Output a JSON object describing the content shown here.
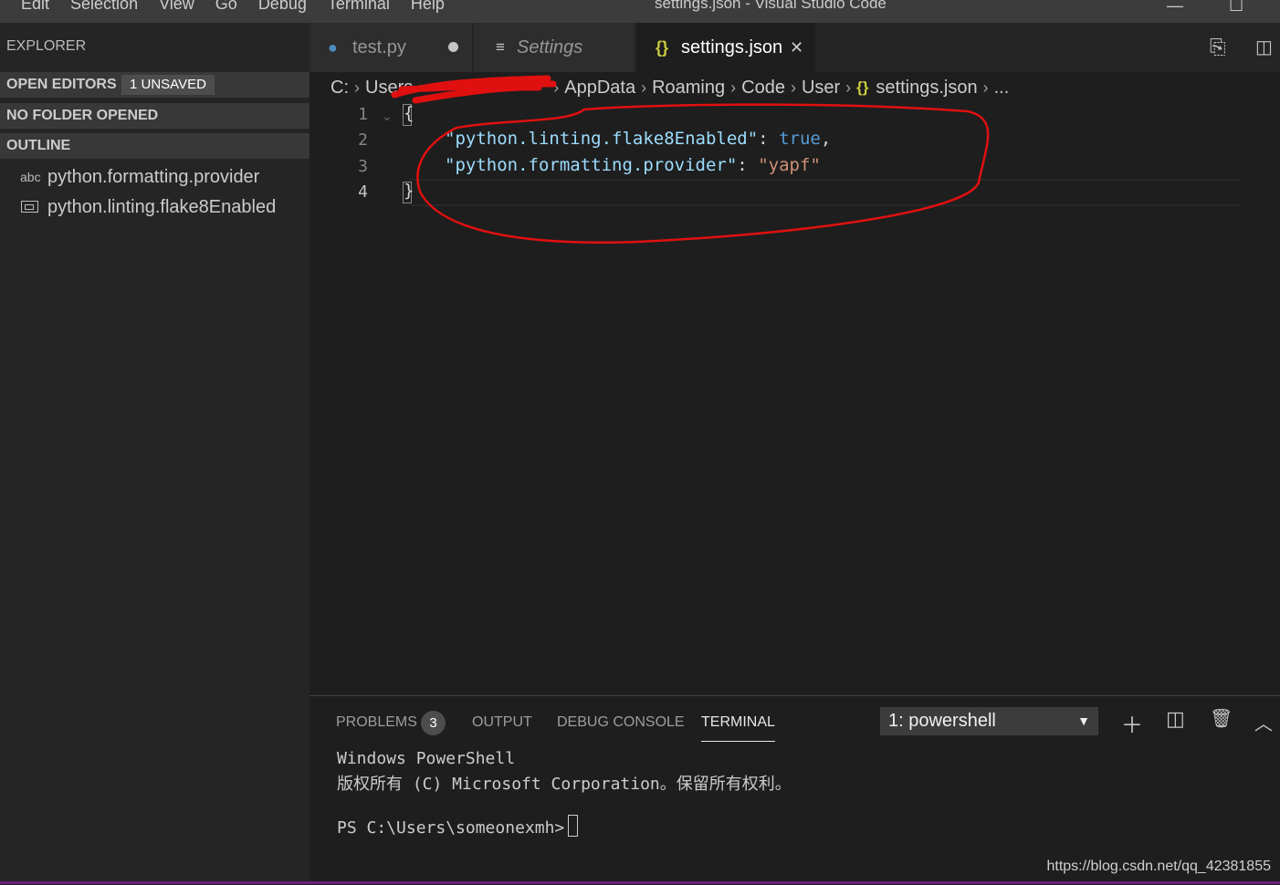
{
  "menu": [
    "Edit",
    "Selection",
    "View",
    "Go",
    "Debug",
    "Terminal",
    "Help"
  ],
  "window_title": "settings.json - Visual Studio Code",
  "window_controls": {
    "minimize": "—",
    "maximize": "☐"
  },
  "sidebar": {
    "title": "EXPLORER",
    "open_editors": {
      "label": "OPEN EDITORS",
      "badge": "1 UNSAVED"
    },
    "no_folder": "NO FOLDER OPENED",
    "outline": {
      "label": "OUTLINE",
      "items": [
        {
          "icon": "string-icon",
          "icon_text": "abc",
          "label": "python.formatting.provider"
        },
        {
          "icon": "property-icon",
          "label": "python.linting.flake8Enabled"
        }
      ]
    }
  },
  "tabs": [
    {
      "label": "test.py",
      "icon": "python-icon",
      "dirty": true
    },
    {
      "label": "Settings",
      "icon": "settings-list-icon"
    },
    {
      "label": "settings.json",
      "icon": "json-icon",
      "icon_text": "{}",
      "active": true,
      "close": "✕"
    }
  ],
  "breadcrumbs": [
    "C:",
    "Users",
    "AppData",
    "Roaming",
    "Code",
    "User",
    "settings.json",
    "..."
  ],
  "editor": {
    "line_numbers": [
      "1",
      "2",
      "3",
      "4"
    ],
    "lines": [
      {
        "open": "{"
      },
      {
        "key": "\"python.linting.flake8Enabled\"",
        "colon": ": ",
        "value": "true",
        "end": ","
      },
      {
        "key": "\"python.formatting.provider\"",
        "colon": ": ",
        "value": "\"yapf\""
      },
      {
        "close": "}"
      }
    ]
  },
  "panel": {
    "tabs": [
      "PROBLEMS",
      "OUTPUT",
      "DEBUG CONSOLE",
      "TERMINAL"
    ],
    "problems_count": "3",
    "terminal_select": "1: powershell",
    "terminal_lines": [
      "Windows PowerShell",
      "版权所有 (C) Microsoft Corporation。保留所有权利。",
      "PS C:\\Users\\someonexmh>"
    ]
  },
  "watermark": "https://blog.csdn.net/qq_42381855",
  "colors": {
    "activity_bg": "#252526",
    "editor_bg": "#1e1e1e",
    "json_key": "#9cdcfe",
    "json_bool": "#569cd6",
    "json_string": "#ce9178",
    "annotation": "#e01010"
  }
}
